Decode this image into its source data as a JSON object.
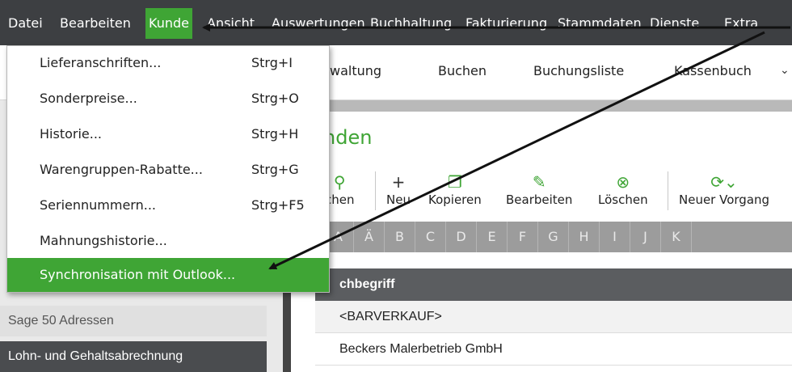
{
  "menubar": {
    "items": [
      "Datei",
      "Bearbeiten",
      "Kunde",
      "Ansicht",
      "Auswertungen",
      "Buchhaltung",
      "Fakturierung",
      "Stammdaten",
      "Dienste",
      "Extra"
    ],
    "active": "Kunde"
  },
  "tabs": [
    "waltung",
    "Buchen",
    "Buchungsliste",
    "Kassenbuch"
  ],
  "dropdown": {
    "items": [
      {
        "label": "Lieferanschriften...",
        "shortcut": "Strg+I"
      },
      {
        "label": "Sonderpreise...",
        "shortcut": "Strg+O"
      },
      {
        "label": "Historie...",
        "shortcut": "Strg+H"
      },
      {
        "label": "Warengruppen-Rabatte...",
        "shortcut": "Strg+G"
      },
      {
        "label": "Seriennummern...",
        "shortcut": "Strg+F5"
      },
      {
        "label": "Mahnungshistorie...",
        "shortcut": ""
      },
      {
        "label": "Synchronisation mit Outlook...",
        "shortcut": ""
      }
    ]
  },
  "sidebar": {
    "items": [
      "Sage 50 Adressen",
      "Lohn- und Gehaltsabrechnung"
    ]
  },
  "content": {
    "title": "nden",
    "actions": [
      {
        "label": "chen",
        "icon": "search-icon"
      },
      {
        "label": "Neu",
        "icon": "plus-icon"
      },
      {
        "label": "Kopieren",
        "icon": "copy-icon"
      },
      {
        "label": "Bearbeiten",
        "icon": "edit-icon"
      },
      {
        "label": "Löschen",
        "icon": "delete-icon"
      },
      {
        "label": "Neuer Vorgang",
        "icon": "new-transaction-icon"
      }
    ],
    "alphabet": [
      "A",
      "Ä",
      "B",
      "C",
      "D",
      "E",
      "F",
      "G",
      "H",
      "I",
      "J",
      "K"
    ],
    "grid_header": "chbegriff",
    "rows": [
      "<BARVERKAUF>",
      "Beckers Malerbetrieb GmbH"
    ]
  },
  "colors": {
    "accent": "#3fa535",
    "menubar": "#3d3f42"
  }
}
